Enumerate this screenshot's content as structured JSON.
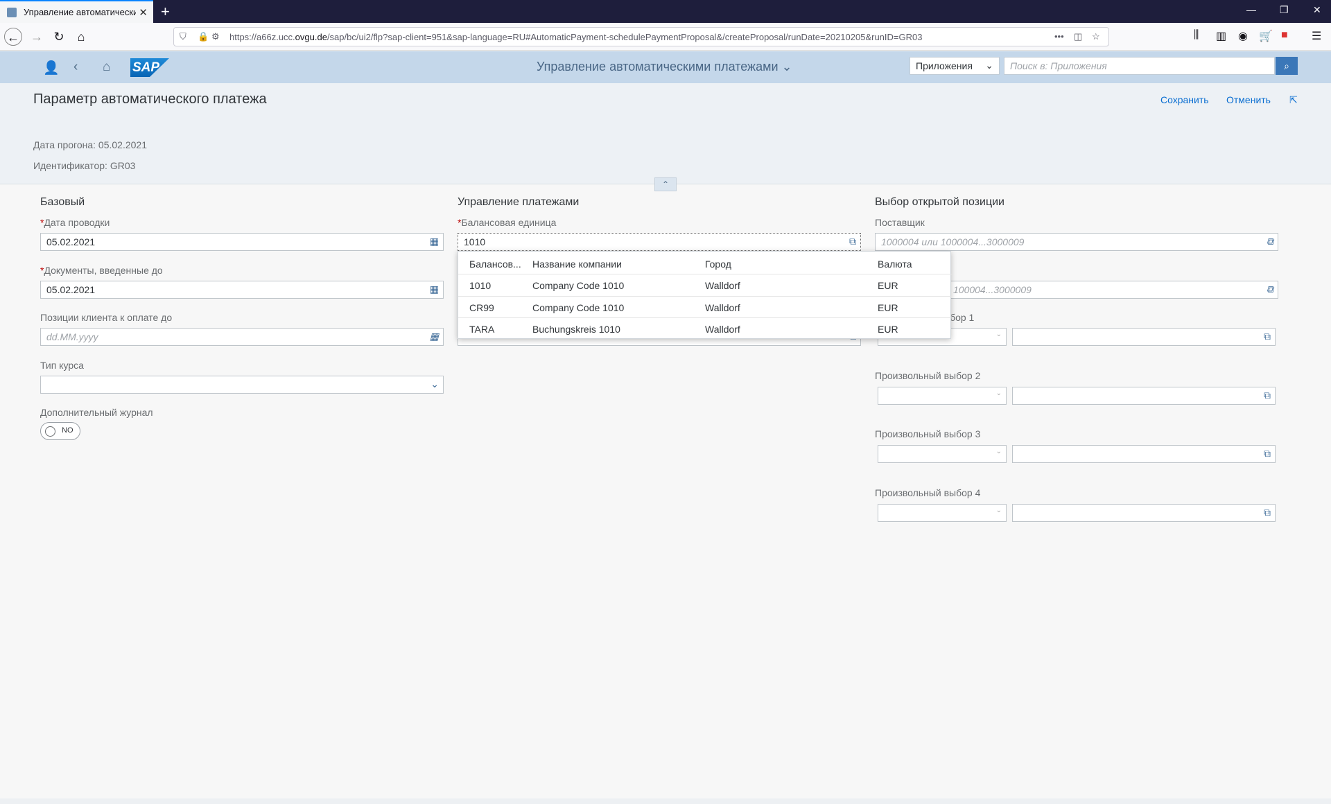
{
  "browser": {
    "tab_title": "Управление автоматическими",
    "url_prefix": "https://a66z.ucc.",
    "url_domain": "ovgu.de",
    "url_rest": "/sap/bc/ui2/flp?sap-client=951&sap-language=RU#AutomaticPayment-schedulePaymentProposal&/createProposal/runDate=20210205&runID=GR03"
  },
  "shell": {
    "app_title": "Управление автоматическими платежами",
    "scope_label": "Приложения",
    "search_placeholder": "Поиск в: Приложения",
    "logo_text": "SAP"
  },
  "header": {
    "title": "Параметр автоматического платежа",
    "save_label": "Сохранить",
    "cancel_label": "Отменить",
    "run_date": "Дата прогона: 05.02.2021",
    "identifier": "Идентификатор: GR03"
  },
  "basic": {
    "title": "Базовый",
    "posting_date_label": "Дата проводки",
    "posting_date_value": "05.02.2021",
    "docs_entered_label": "Документы, введенные до",
    "docs_entered_value": "05.02.2021",
    "customer_items_label": "Позиции клиента к оплате до",
    "customer_items_placeholder": "dd.MM.yyyy",
    "rate_type_label": "Тип курса",
    "extra_log_label": "Дополнительный журнал",
    "toggle_text": "NO"
  },
  "payment": {
    "title": "Управление платежами",
    "company_code_label": "Балансовая единица",
    "company_code_value": "1010"
  },
  "open_items": {
    "title": "Выбор открытой позиции",
    "vendor_label": "Поставщик",
    "vendor_placeholder": "1000004 или 1000004...3000009",
    "customer_placeholder_partial": "100004...3000009",
    "free1_partial": "ыбор 1",
    "free2_label": "Произвольный выбор 2",
    "free3_label": "Произвольный выбор 3",
    "free4_label": "Произвольный выбор 4"
  },
  "suggestions": {
    "headers": [
      "Балансов...",
      "Название компании",
      "Город",
      "Валюта"
    ],
    "rows": [
      {
        "code": "1010",
        "name": "Company Code 1010",
        "city": "Walldorf",
        "currency": "EUR"
      },
      {
        "code": "CR99",
        "name": "Company Code 1010",
        "city": "Walldorf",
        "currency": "EUR"
      },
      {
        "code": "TARA",
        "name": "Buchungskreis 1010",
        "city": "Walldorf",
        "currency": "EUR"
      }
    ]
  },
  "icons": [
    "calendar-icon",
    "value-help-icon",
    "chevron-down-icon",
    "search-icon",
    "user-icon",
    "back-icon",
    "home-icon",
    "export-icon"
  ]
}
